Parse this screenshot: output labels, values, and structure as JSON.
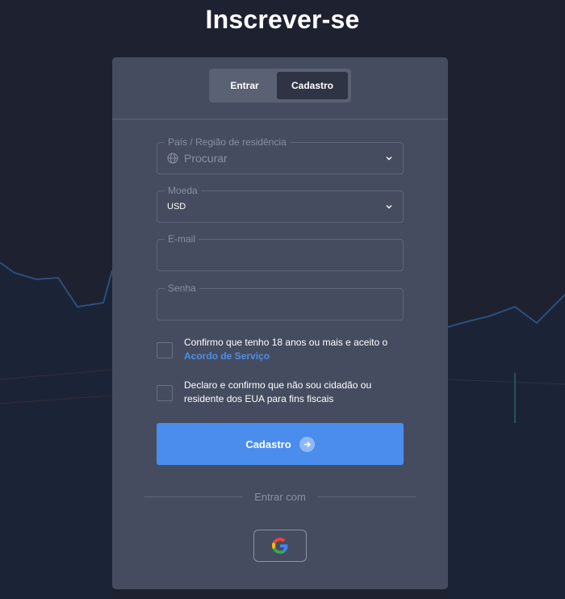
{
  "page": {
    "title": "Inscrever-se"
  },
  "tabs": [
    {
      "label": "Entrar",
      "active": false
    },
    {
      "label": "Cadastro",
      "active": true
    }
  ],
  "form": {
    "country": {
      "label": "País / Região de residência",
      "placeholder": "Procurar"
    },
    "currency": {
      "label": "Moeda",
      "value": "USD"
    },
    "email": {
      "label": "E-mail",
      "value": ""
    },
    "password": {
      "label": "Senha",
      "value": ""
    },
    "age_consent": {
      "text": "Confirmo que tenho 18 anos ou mais e aceito o",
      "link": "Acordo de Serviço",
      "checked": false
    },
    "usa_declaration": {
      "text": "Declaro e confirmo que não sou cidadão ou residente dos EUA para fins fiscais",
      "checked": false
    },
    "submit_label": "Cadastro"
  },
  "social": {
    "label": "Entrar com",
    "providers": [
      "google-icon"
    ]
  },
  "colors": {
    "background": "#1d2130",
    "card": "#454c5f",
    "accent": "#4a8ded",
    "link": "#4a90e8"
  }
}
